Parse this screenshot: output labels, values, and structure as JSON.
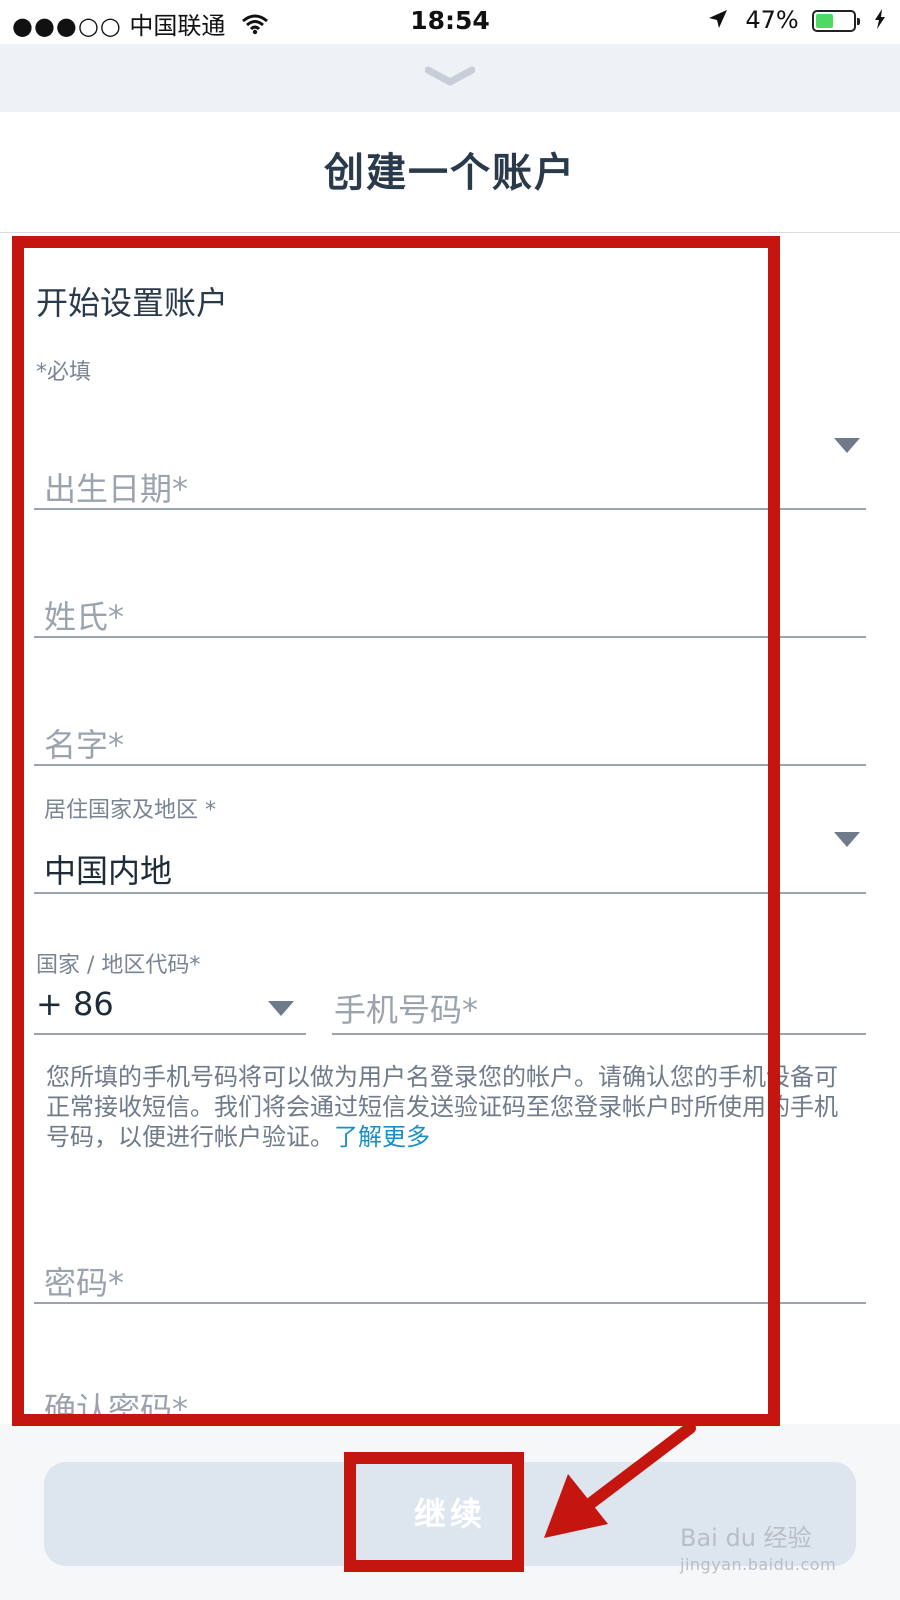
{
  "status_bar": {
    "signal": "●●●○○",
    "carrier": "中国联通",
    "time": "18:54",
    "battery_percent": "47%",
    "battery_level": 0.47
  },
  "header": {
    "title": "创建一个账户"
  },
  "form": {
    "heading": "开始设置账户",
    "required_note": "*必填",
    "birthdate_placeholder": "出生日期*",
    "surname_placeholder": "姓氏*",
    "given_name_placeholder": "名字*",
    "country_label": "居住国家及地区 *",
    "country_value": "中国内地",
    "code_label": "国家 / 地区代码*",
    "code_value": "+ 86",
    "phone_placeholder": "手机号码*",
    "help_text": "您所填的手机号码将可以做为用户名登录您的帐户。请确认您的手机设备可正常接收短信。我们将会通过短信发送验证码至您登录帐户时所使用的手机号码，以便进行帐户验证。",
    "help_link": "了解更多",
    "password_placeholder": "密码*",
    "confirm_password_placeholder": "确认密码*"
  },
  "footer": {
    "continue_label": "继续"
  },
  "watermark": {
    "brand": "Bai du 经验",
    "url": "jingyan.baidu.com"
  },
  "colors": {
    "annotation_red": "#c4160e",
    "link_blue": "#1a8fc4",
    "battery_green": "#4cd964"
  }
}
